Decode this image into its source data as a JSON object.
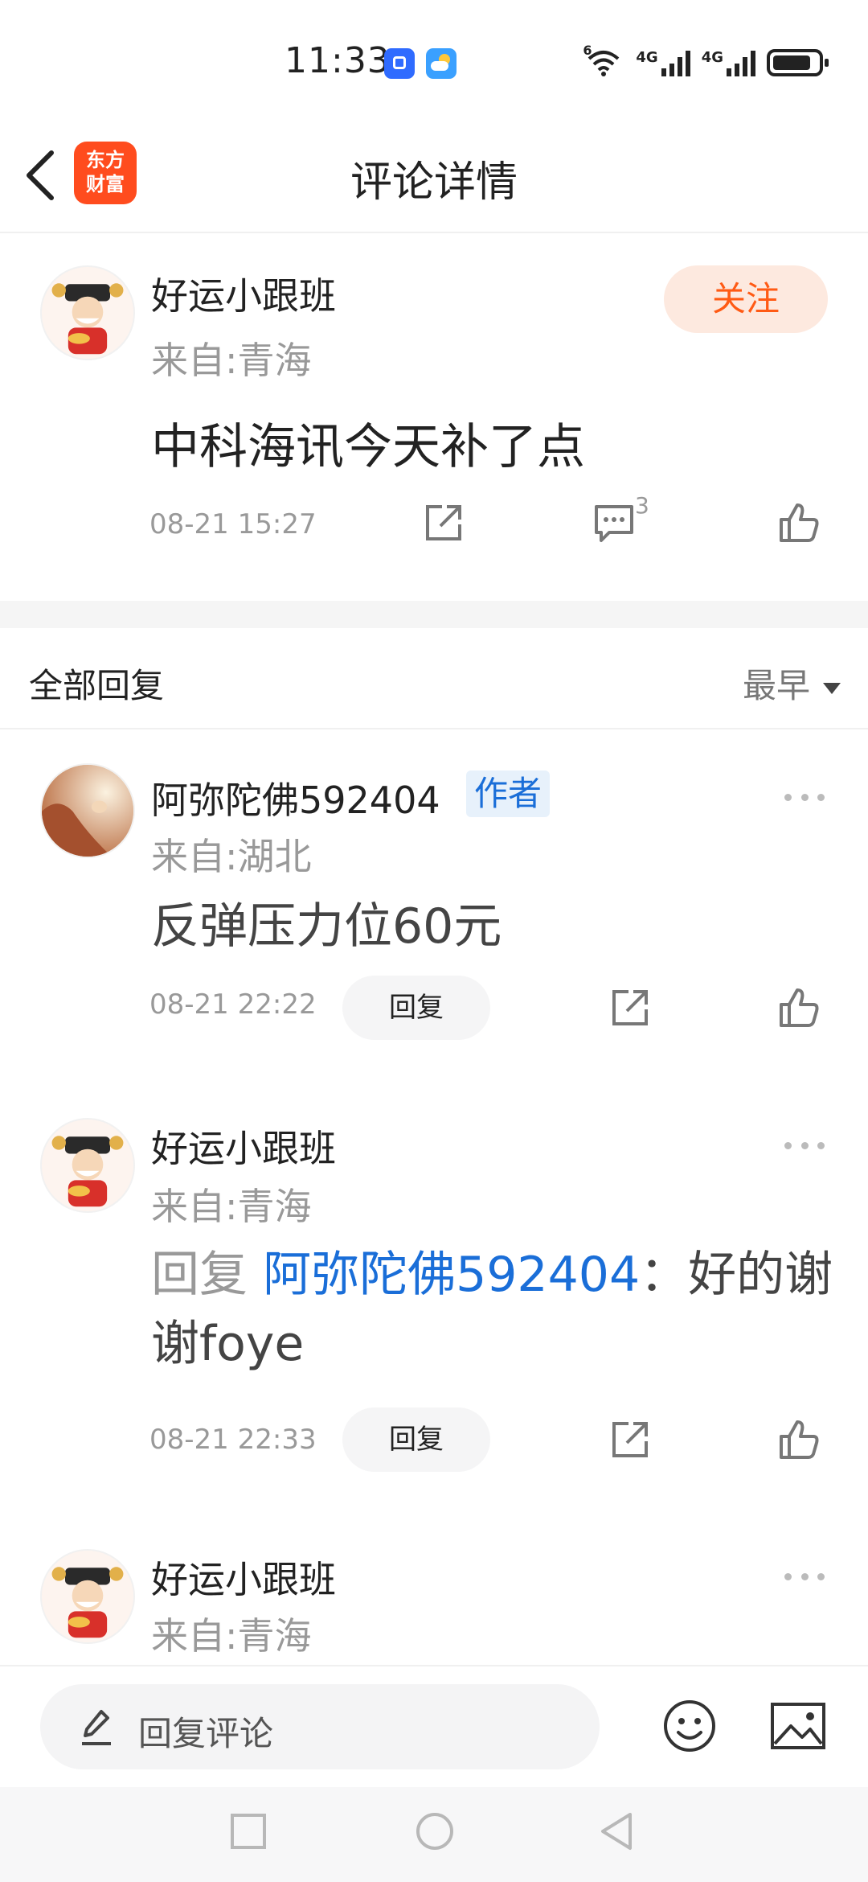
{
  "status_bar": {
    "time": "11:33",
    "wifi_label": "6",
    "net1": "4G",
    "net2": "4G"
  },
  "header": {
    "title": "评论详情",
    "logo_line1": "东方",
    "logo_line2": "财富"
  },
  "post": {
    "username": "好运小跟班",
    "location": "来自:青海",
    "follow_label": "关注",
    "content": "中科海讯今天补了点",
    "time": "08-21 15:27",
    "comment_count": "3"
  },
  "replies_header": {
    "title": "全部回复",
    "sort_label": "最早"
  },
  "replies": [
    {
      "username": "阿弥陀佛592404",
      "author_tag": "作者",
      "location": "来自:湖北",
      "content": "反弹压力位60元",
      "time": "08-21 22:22",
      "reply_label": "回复"
    },
    {
      "username": "好运小跟班",
      "location": "来自:青海",
      "prefix": "回复",
      "mention": "阿弥陀佛592404",
      "content": "：好的谢谢foye",
      "time": "08-21 22:33",
      "reply_label": "回复"
    },
    {
      "username": "好运小跟班",
      "location": "来自:青海"
    }
  ],
  "bottom_bar": {
    "input_placeholder": "回复评论"
  },
  "colors": {
    "accent": "#ff5a14",
    "link": "#1a6ed8",
    "brand": "#ff4c1e"
  }
}
